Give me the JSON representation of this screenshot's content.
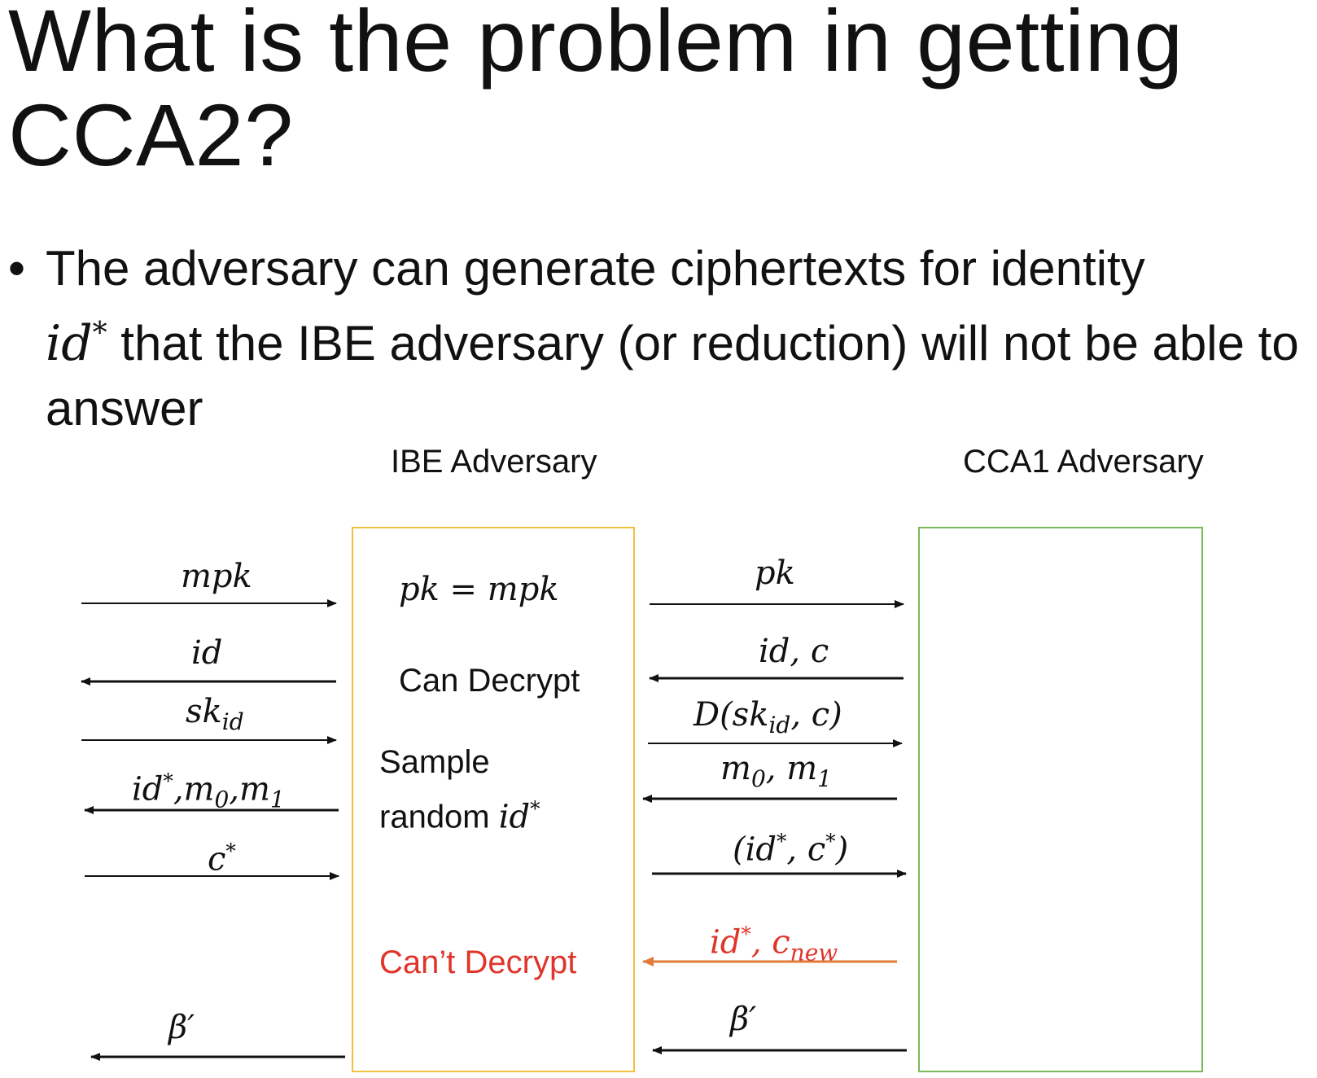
{
  "slide": {
    "title": "What is the problem in getting CCA2?",
    "bullet": {
      "marker": "•",
      "text_part1": "The adversary can generate ciphertexts for identity ",
      "math_id": "id",
      "math_star": "*",
      "text_part2": " that the IBE adversary (or reduction) will not be able to answer"
    }
  },
  "diagram": {
    "headers": {
      "ibe": "IBE Adversary",
      "cca1": "CCA1 Adversary"
    },
    "left_labels": {
      "mpk": "mpk",
      "id": "id",
      "sk_base": "sk",
      "sk_sub": "id",
      "idstar_base": "id",
      "idstar_sup": "*",
      "m0m1_text": ",m",
      "m0_sub": "0",
      "m1_text": ",m",
      "m1_sub": "1",
      "cstar_base": "c",
      "cstar_sup": "*",
      "beta": "β′"
    },
    "ibe_box": {
      "pk_eq": "pk = mpk",
      "can_decrypt": "Can Decrypt",
      "sample": "Sample",
      "random": "random ",
      "random_id": "id",
      "random_star": "*",
      "cant_decrypt": "Can’t  Decrypt"
    },
    "right_labels": {
      "pk": "pk",
      "idc": "id, c",
      "dec_prefix": "D(sk",
      "dec_sub": "id",
      "dec_suffix": ", c)",
      "m0m1_prefix": "m",
      "m0_sub": "0",
      "m1_mid": ", m",
      "m1_sub": "1",
      "challenge_prefix": "(id",
      "challenge_star1": "*",
      "challenge_mid": ", c",
      "challenge_star2": "*",
      "challenge_suffix": ")",
      "new_prefix": "id",
      "new_star": "*",
      "new_mid": ", c",
      "new_sub": "new",
      "beta": "β′"
    },
    "colors": {
      "ibe_box": "#f0c040",
      "cca1_box": "#7ab85a",
      "highlight_text": "#e0352b",
      "highlight_arrow": "#e07b3a",
      "default": "#111111"
    }
  }
}
